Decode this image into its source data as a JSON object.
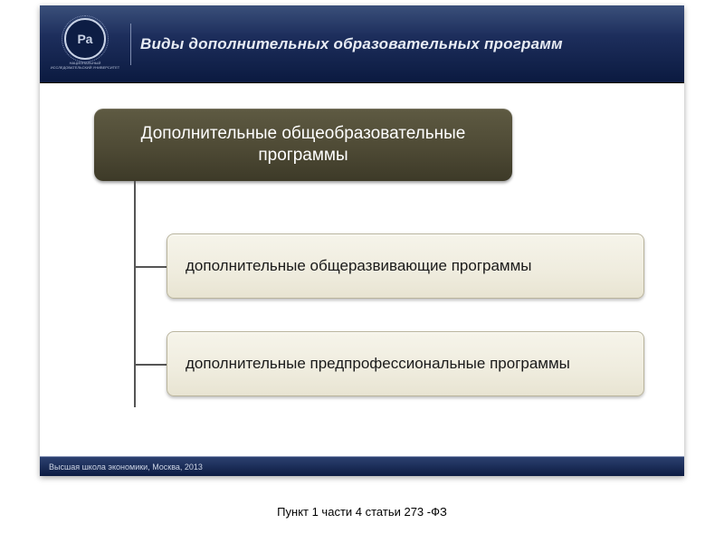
{
  "header": {
    "logo_text": "Ра",
    "logo_subtitle": "НАЦИОНАЛЬНЫЙ ИССЛЕДОВАТЕЛЬСКИЙ УНИВЕРСИТЕТ",
    "title": "Виды дополнительных образовательных программ"
  },
  "diagram": {
    "root": "Дополнительные общеобразовательные программы",
    "children": [
      "дополнительные общеразвивающие программы",
      "дополнительные предпрофессиональные программы"
    ]
  },
  "footer": {
    "text": "Высшая школа экономики, Москва, 2013"
  },
  "caption": "Пункт 1 части 4 статьи 273 -ФЗ"
}
